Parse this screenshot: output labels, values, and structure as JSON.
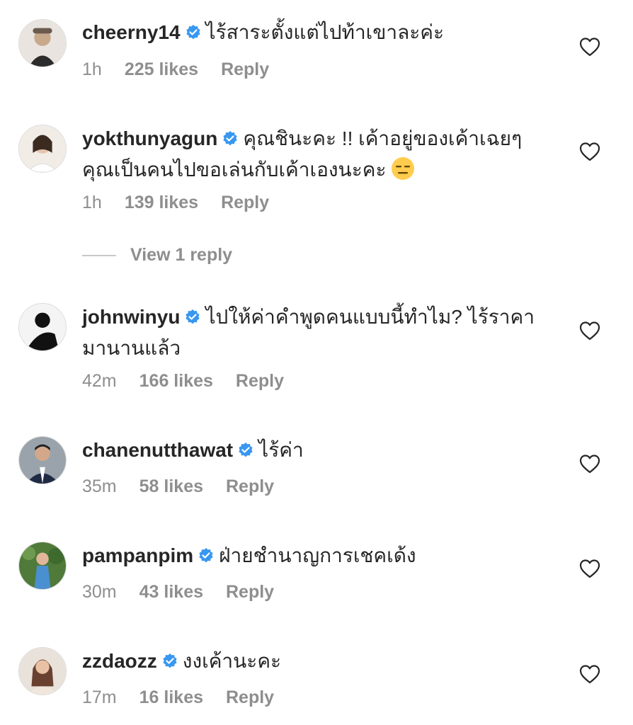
{
  "comments": [
    {
      "username": "cheerny14",
      "text": "ไร้สาระตั้งแต่ไปท้าเขาละค่ะ",
      "time": "1h",
      "likes": "225 likes",
      "reply": "Reply"
    },
    {
      "username": "yokthunyagun",
      "text": "คุณชินะคะ !! เค้าอยู่ของเค้าเฉยๆ คุณเป็นคนไปขอเล่นกับเค้าเองนะคะ",
      "time": "1h",
      "likes": "139 likes",
      "reply": "Reply"
    },
    {
      "username": "johnwinyu",
      "text": "ไปให้ค่าคำพูดคนแบบนี้ทำไม? ไร้ราคามานานแล้ว",
      "time": "42m",
      "likes": "166 likes",
      "reply": "Reply"
    },
    {
      "username": "chanenutthawat",
      "text": "ไร้ค่า",
      "time": "35m",
      "likes": "58 likes",
      "reply": "Reply"
    },
    {
      "username": "pampanpim",
      "text": "ฝ่ายชำนาญการเชคเด้ง",
      "time": "30m",
      "likes": "43 likes",
      "reply": "Reply"
    },
    {
      "username": "zzdaozz",
      "text": "งงเค้านะคะ",
      "time": "17m",
      "likes": "16 likes",
      "reply": "Reply"
    }
  ],
  "view_replies": "View 1 reply",
  "colors": {
    "verified": "#3897f0",
    "meta": "#8e8e8e",
    "text": "#262626"
  }
}
